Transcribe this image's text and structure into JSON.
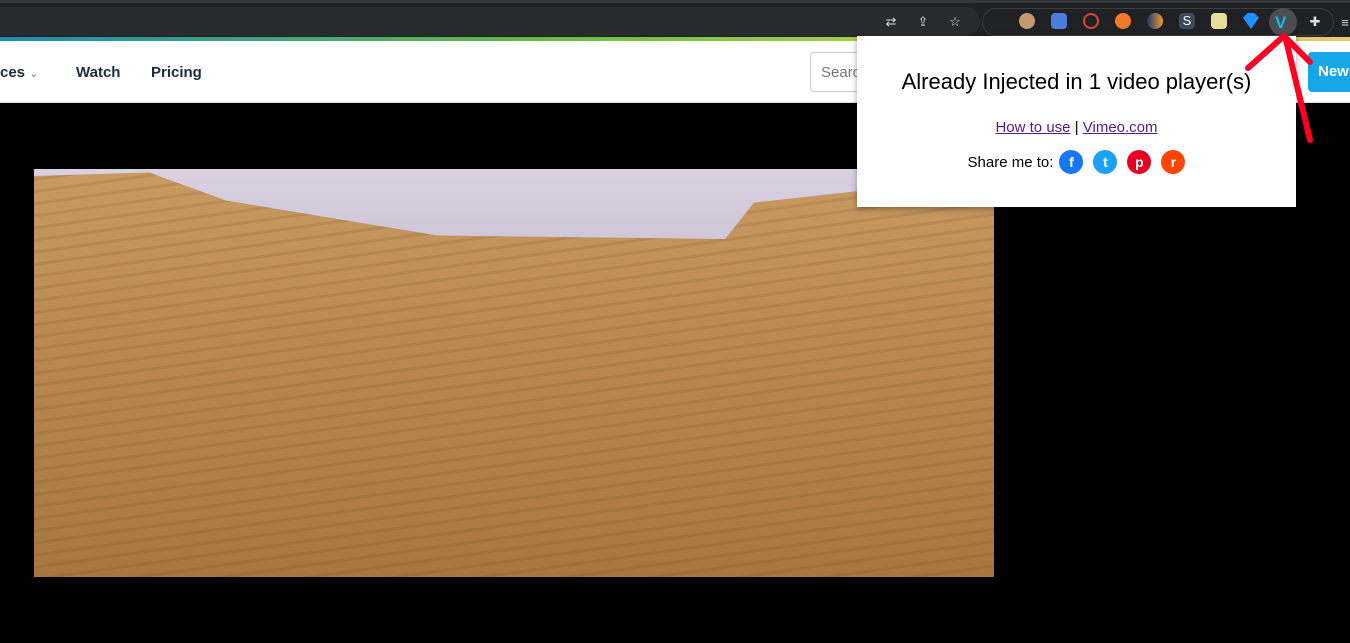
{
  "browser": {
    "toolbar_icons": [
      "translate-icon",
      "share-icon",
      "bookmark-star-icon"
    ],
    "extensions": [
      {
        "name": "owl-extension",
        "color": "#c49a6c"
      },
      {
        "name": "google-translate-extension",
        "color": "#4a7de0"
      },
      {
        "name": "red-circle-extension",
        "color": "#e0442a"
      },
      {
        "name": "robot-extension",
        "color": "#f07a2a"
      },
      {
        "name": "moon-extension",
        "color": "#f29a2e"
      },
      {
        "name": "s-extension",
        "color": "#3b4a5a"
      },
      {
        "name": "notepad-extension",
        "color": "#e8dc9a"
      },
      {
        "name": "diamond-extension",
        "color": "#1e90ff"
      },
      {
        "name": "vimeo-downloader-extension",
        "color": "#1ab7ea"
      }
    ],
    "s_letter": "S"
  },
  "nav": {
    "partial_item": "ces",
    "watch": "Watch",
    "pricing": "Pricing",
    "search_placeholder": "Search",
    "new_button": "New"
  },
  "popup": {
    "title": "Already Injected in 1 video player(s)",
    "how_to_use": "How to use",
    "separator": "|",
    "vimeo_link": "Vimeo.com",
    "share_label": "Share me to:",
    "share": [
      {
        "name": "facebook",
        "glyph": "f",
        "color": "#1877f2"
      },
      {
        "name": "twitter",
        "glyph": "t",
        "color": "#1da1f2"
      },
      {
        "name": "pinterest",
        "glyph": "p",
        "color": "#e60023"
      },
      {
        "name": "reddit",
        "glyph": "r",
        "color": "#ff4500"
      }
    ]
  },
  "annotation_color": "#ff0022"
}
